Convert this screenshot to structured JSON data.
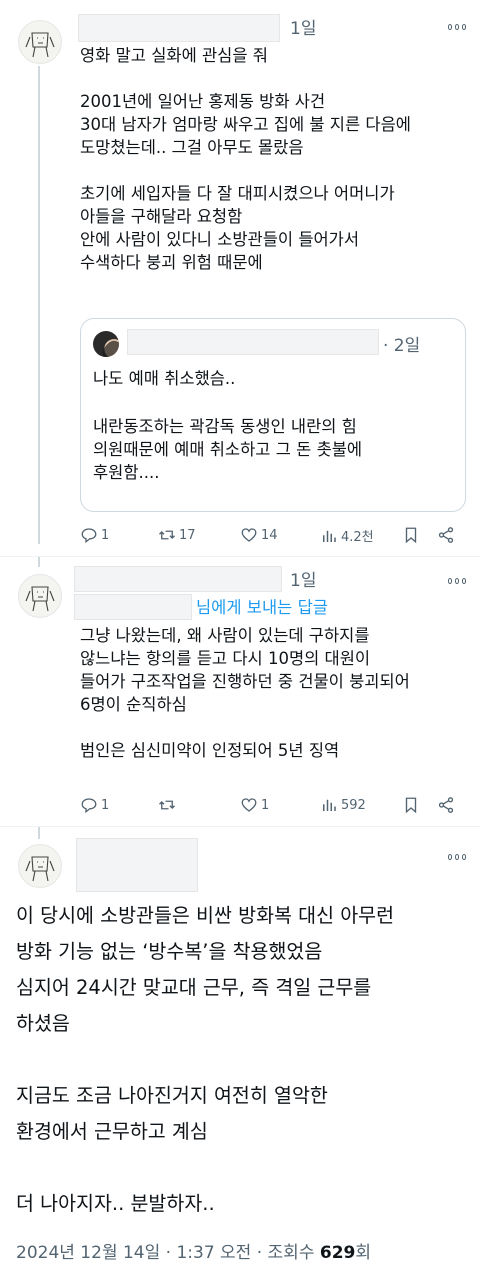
{
  "tweet1": {
    "avatar": "cartoon-avatar",
    "time": "1일",
    "body": "영화 말고 실화에 관심을 줘\n\n2001년에 일어난 홍제동 방화 사건\n30대 남자가 엄마랑 싸우고 집에 불 지른 다음에\n도망쳤는데.. 그걸 아무도 몰랐음\n\n초기에 세입자들 다 잘 대피시켰으나 어머니가\n아들을 구해달라 요청함\n안에 사람이 있다니 소방관들이 들어가서\n수색하다 붕괴 위험 때문에",
    "quote": {
      "time": "· 2일",
      "line1": "나도 예매 취소했슴..",
      "body": "내란동조하는 곽감독 동생인 내란의 힘\n의원때문에 예매 취소하고 그 돈 촛불에\n후원함...."
    },
    "actions": {
      "replies": "1",
      "retweets": "17",
      "likes": "14",
      "views": "4.2천"
    }
  },
  "tweet2": {
    "avatar": "cartoon-avatar",
    "time": "1일",
    "reply_to": "님에게 보내는 답글",
    "body": "그냥 나왔는데, 왜 사람이 있는데 구하지를\n않느냐는 항의를 듣고 다시 10명의 대원이\n들어가 구조작업을 진행하던 중 건물이 붕괴되어\n6명이 순직하심\n\n범인은 심신미약이 인정되어 5년 징역",
    "actions": {
      "replies": "1",
      "retweets": "",
      "likes": "1",
      "views": "592"
    }
  },
  "main_tweet": {
    "avatar": "cartoon-avatar",
    "body": "이 당시에 소방관들은 비싼 방화복 대신 아무런\n방화 기능 없는 ‘방수복’을 착용했었음\n심지어 24시간 맞교대 근무, 즉 격일 근무를\n하셨음\n\n지금도 조금 나아진거지 여전히 열악한\n환경에서 근무하고 계심\n\n더 나아지자.. 분발하자..",
    "meta_prefix": "2024년 12월 14일 · 1:37 오전 · 조회수 ",
    "views_count": "629",
    "views_suffix": "회"
  }
}
